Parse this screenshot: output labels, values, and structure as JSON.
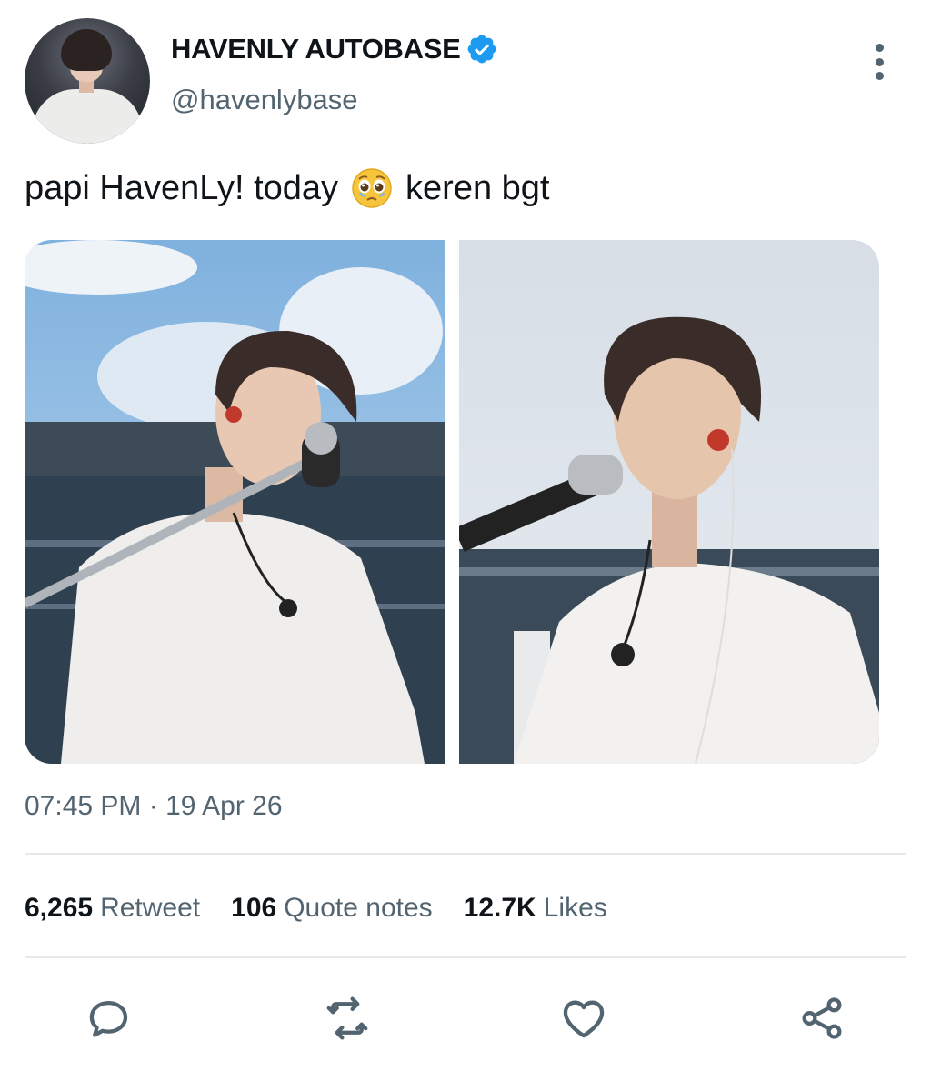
{
  "author": {
    "display_name": "HAVENLY AUTOBASE",
    "handle": "@havenlybase",
    "verified": true
  },
  "tweet": {
    "text_before": "papi HavenLy! today",
    "emoji": "pleading-face-with-tears-emoji",
    "text_after": "keren bgt",
    "photos": [
      {
        "description_icon": "concert-photo-left"
      },
      {
        "description_icon": "concert-photo-right"
      }
    ]
  },
  "meta": {
    "time": "07:45 PM",
    "separator": "·",
    "date": "19 Apr 26"
  },
  "stats": {
    "retweets": {
      "count": "6,265",
      "label": "Retweet"
    },
    "quotes": {
      "count": "106",
      "label": "Quote notes"
    },
    "likes": {
      "count": "12.7K",
      "label": "Likes"
    }
  },
  "actions": [
    "reply-icon",
    "retweet-icon",
    "like-icon",
    "share-icon"
  ],
  "colors": {
    "text": "#0f1419",
    "secondary": "#536471",
    "verified": "#1d9bf0",
    "divider": "#e6e8ea"
  }
}
